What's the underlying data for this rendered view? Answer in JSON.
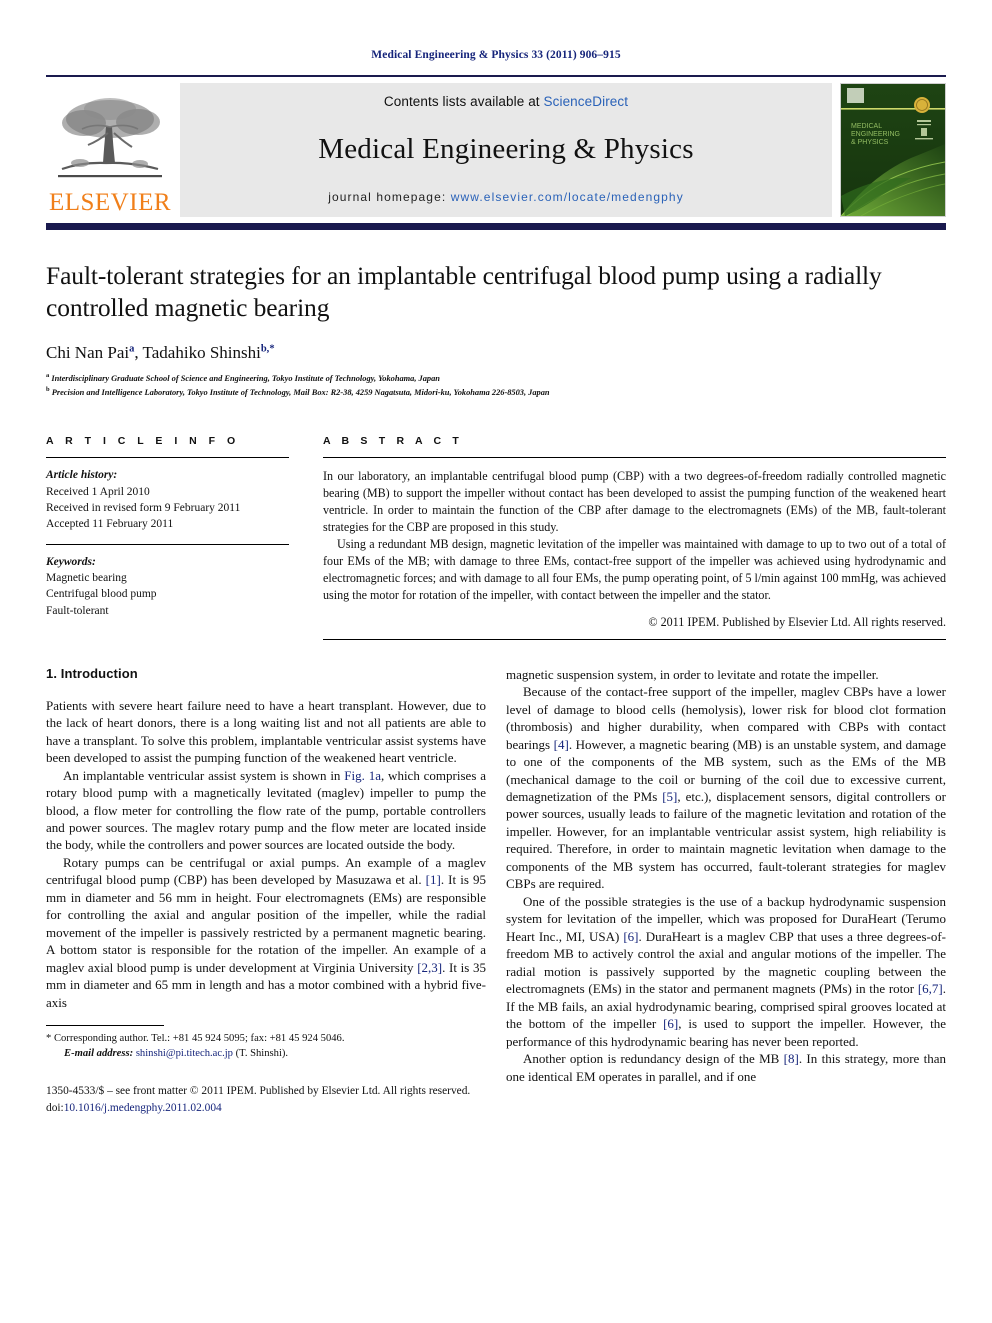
{
  "running_head": "Medical Engineering & Physics 33 (2011) 906–915",
  "masthead": {
    "publisher_logo_text": "ELSEVIER",
    "contents_line_prefix": "Contents lists available at ",
    "contents_line_link": "ScienceDirect",
    "journal_title": "Medical Engineering & Physics",
    "homepage_prefix": "journal homepage: ",
    "homepage_url": "www.elsevier.com/locate/medengphy",
    "cover_title_line1": "MEDICAL",
    "cover_title_line2": "ENGINEERING",
    "cover_title_line3": "& PHYSICS"
  },
  "article": {
    "title": "Fault-tolerant strategies for an implantable centrifugal blood pump using a radially controlled magnetic bearing",
    "authors_html": "Chi Nan Pai<sup>a</sup>, Tadahiko Shinshi<sup>b,</sup><sup>*</sup>",
    "affiliation_a": "Interdisciplinary Graduate School of Science and Engineering, Tokyo Institute of Technology, Yokohama, Japan",
    "affiliation_b": "Precision and Intelligence Laboratory, Tokyo Institute of Technology, Mail Box: R2-38, 4259 Nagatsuta, Midori-ku, Yokohama 226-8503, Japan"
  },
  "article_info": {
    "heading": "A R T I C L E   I N F O",
    "history_label": "Article history:",
    "history": [
      "Received 1 April 2010",
      "Received in revised form 9 February 2011",
      "Accepted 11 February 2011"
    ],
    "keywords_label": "Keywords:",
    "keywords": [
      "Magnetic bearing",
      "Centrifugal blood pump",
      "Fault-tolerant"
    ]
  },
  "abstract": {
    "heading": "A B S T R A C T",
    "paragraph1": "In our laboratory, an implantable centrifugal blood pump (CBP) with a two degrees-of-freedom radially controlled magnetic bearing (MB) to support the impeller without contact has been developed to assist the pumping function of the weakened heart ventricle. In order to maintain the function of the CBP after damage to the electromagnets (EMs) of the MB, fault-tolerant strategies for the CBP are proposed in this study.",
    "paragraph2": "Using a redundant MB design, magnetic levitation of the impeller was maintained with damage to up to two out of a total of four EMs of the MB; with damage to three EMs, contact-free support of the impeller was achieved using hydrodynamic and electromagnetic forces; and with damage to all four EMs, the pump operating point, of 5 l/min against 100 mmHg, was achieved using the motor for rotation of the impeller, with contact between the impeller and the stator.",
    "copyright": "© 2011 IPEM. Published by Elsevier Ltd. All rights reserved."
  },
  "body": {
    "section_heading": "1. Introduction",
    "left_paragraphs": [
      "Patients with severe heart failure need to have a heart transplant. However, due to the lack of heart donors, there is a long waiting list and not all patients are able to have a transplant. To solve this problem, implantable ventricular assist systems have been developed to assist the pumping function of the weakened heart ventricle.",
      "An implantable ventricular assist system is shown in Fig. 1a, which comprises a rotary blood pump with a magnetically levitated (maglev) impeller to pump the blood, a flow meter for controlling the flow rate of the pump, portable controllers and power sources. The maglev rotary pump and the flow meter are located inside the body, while the controllers and power sources are located outside the body.",
      "Rotary pumps can be centrifugal or axial pumps. An example of a maglev centrifugal blood pump (CBP) has been developed by Masuzawa et al. [1]. It is 95 mm in diameter and 56 mm in height. Four electromagnets (EMs) are responsible for controlling the axial and angular position of the impeller, while the radial movement of the impeller is passively restricted by a permanent magnetic bearing. A bottom stator is responsible for the rotation of the impeller. An example of a maglev axial blood pump is under development at Virginia University [2,3]. It is 35 mm in diameter and 65 mm in length and has a motor combined with a hybrid five-axis"
    ],
    "right_paragraphs": [
      "magnetic suspension system, in order to levitate and rotate the impeller.",
      "Because of the contact-free support of the impeller, maglev CBPs have a lower level of damage to blood cells (hemolysis), lower risk for blood clot formation (thrombosis) and higher durability, when compared with CBPs with contact bearings [4]. However, a magnetic bearing (MB) is an unstable system, and damage to one of the components of the MB system, such as the EMs of the MB (mechanical damage to the coil or burning of the coil due to excessive current, demagnetization of the PMs [5], etc.), displacement sensors, digital controllers or power sources, usually leads to failure of the magnetic levitation and rotation of the impeller. However, for an implantable ventricular assist system, high reliability is required. Therefore, in order to maintain magnetic levitation when damage to the components of the MB system has occurred, fault-tolerant strategies for maglev CBPs are required.",
      "One of the possible strategies is the use of a backup hydrodynamic suspension system for levitation of the impeller, which was proposed for DuraHeart (Terumo Heart Inc., MI, USA) [6]. DuraHeart is a maglev CBP that uses a three degrees-of-freedom MB to actively control the axial and angular motions of the impeller. The radial motion is passively supported by the magnetic coupling between the electromagnets (EMs) in the stator and permanent magnets (PMs) in the rotor [6,7]. If the MB fails, an axial hydrodynamic bearing, comprised spiral grooves located at the bottom of the impeller [6], is used to support the impeller. However, the performance of this hydrodynamic bearing has never been reported.",
      "Another option is redundancy design of the MB [8]. In this strategy, more than one identical EM operates in parallel, and if one"
    ]
  },
  "footnotes": {
    "corresponding": "* Corresponding author. Tel.: +81 45 924 5095; fax: +81 45 924 5046.",
    "email_label": "E-mail address:",
    "email": "shinshi@pi.titech.ac.jp",
    "email_suffix": " (T. Shinshi).",
    "front_matter": "1350-4533/$ – see front matter © 2011 IPEM. Published by Elsevier Ltd. All rights reserved.",
    "doi_label": "doi:",
    "doi": "10.1016/j.medengphy.2011.02.004"
  },
  "colors": {
    "link": "#16257b",
    "science_direct": "#2a62b8",
    "elsevier_orange": "#f07f1a",
    "rule_navy": "#1a1a4e"
  }
}
